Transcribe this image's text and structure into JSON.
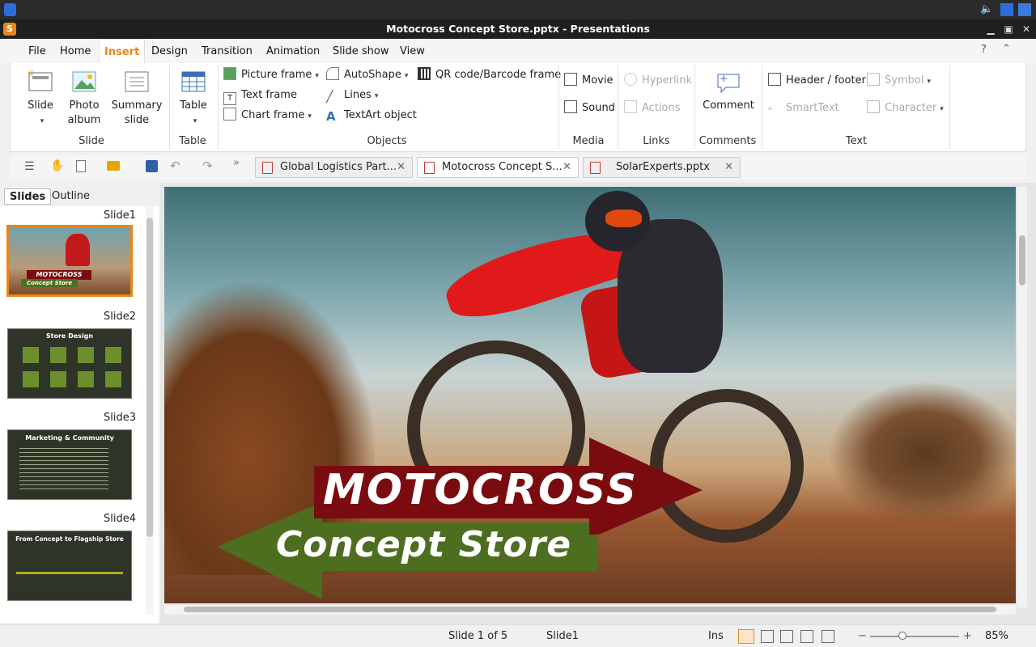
{
  "window": {
    "title": "Motocross Concept Store.pptx - Presentations"
  },
  "menu": [
    "File",
    "Home",
    "Insert",
    "Design",
    "Transition",
    "Animation",
    "Slide show",
    "View"
  ],
  "menu_active": "Insert",
  "ribbon": {
    "slide": {
      "label": "Slide",
      "sublabel": "Slide"
    },
    "photo_album": {
      "line1": "Photo",
      "line2": "album"
    },
    "summary": {
      "line1": "Summary",
      "line2": "slide"
    },
    "table": {
      "label": "Table",
      "group": "Table"
    },
    "objects": {
      "picture": "Picture frame",
      "text": "Text frame",
      "chart": "Chart frame",
      "autoshape": "AutoShape",
      "lines": "Lines",
      "textart": "TextArt object",
      "qr": "QR code/Barcode frame",
      "group": "Objects"
    },
    "media": {
      "movie": "Movie",
      "sound": "Sound",
      "group": "Media"
    },
    "links": {
      "hyperlink": "Hyperlink",
      "actions": "Actions",
      "group": "Links"
    },
    "comments": {
      "comment": "Comment",
      "group": "Comments"
    },
    "text": {
      "header": "Header / footer",
      "smarttext": "SmartText",
      "symbol": "Symbol",
      "character": "Character",
      "group": "Text"
    }
  },
  "doc_tabs": [
    {
      "name": "Global Logistics Part..."
    },
    {
      "name": "Motocross Concept S..."
    },
    {
      "name": "SolarExperts.pptx"
    }
  ],
  "panel": {
    "tabs": [
      "Slides",
      "Outline"
    ],
    "slides": [
      {
        "label": "Slide1",
        "thumb_title": "MOTOCROSS",
        "thumb_sub": "Concept Store"
      },
      {
        "label": "Slide2",
        "thumb_title": "Store Design"
      },
      {
        "label": "Slide3",
        "thumb_title": "Marketing & Community"
      },
      {
        "label": "Slide4",
        "thumb_title": "From Concept to Flagship Store"
      }
    ]
  },
  "slide": {
    "title": "MOTOCROSS",
    "subtitle": "Concept Store"
  },
  "status": {
    "position": "Slide 1 of 5",
    "name": "Slide1",
    "mode": "Ins",
    "zoom": "85%"
  },
  "colors": {
    "accent": "#e8861a",
    "banner_red": "#7a0c10",
    "banner_green": "#4e6e1f"
  }
}
